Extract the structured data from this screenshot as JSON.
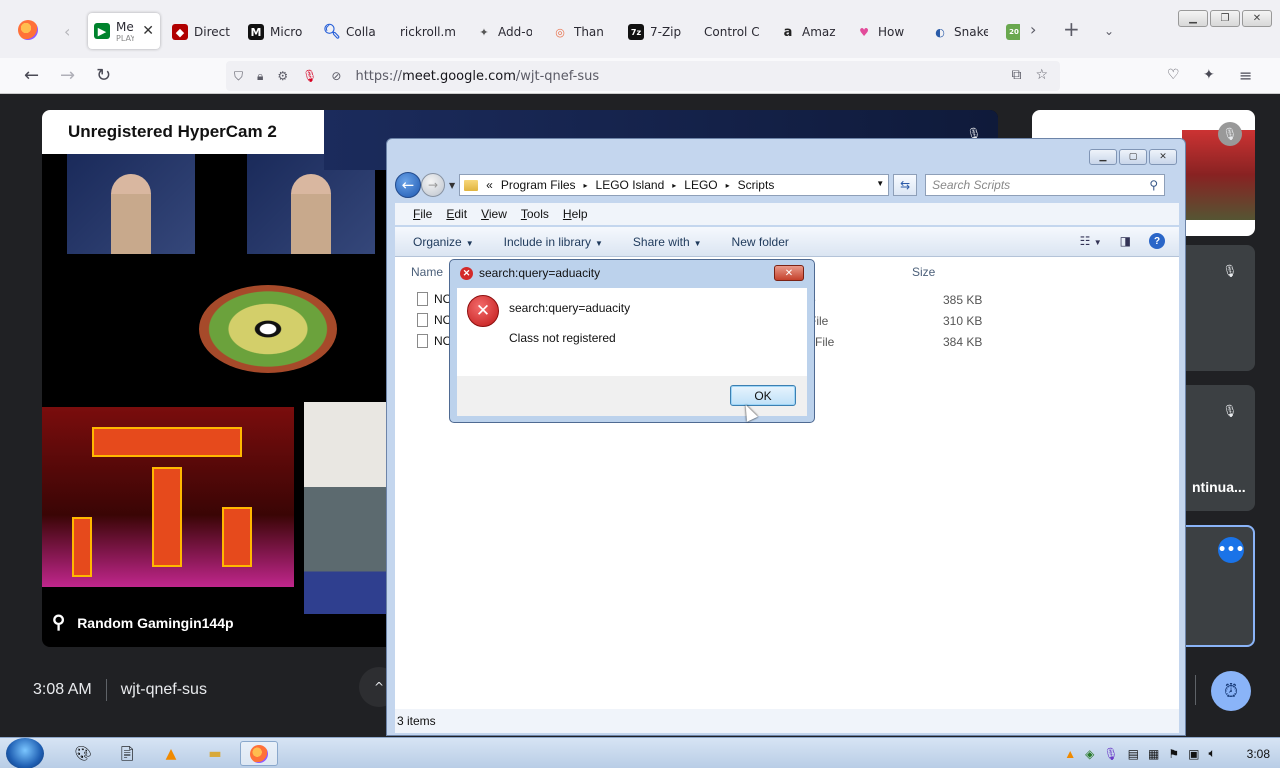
{
  "browser": {
    "tabs": [
      {
        "label": "Meet",
        "sub": "PLAYING",
        "fav_color": "#00832d",
        "fav_glyph": "▶",
        "active": true
      },
      {
        "label": "Direct",
        "fav_color": "#b10000",
        "fav_glyph": "◆"
      },
      {
        "label": "Micro",
        "fav_color": "#111111",
        "fav_glyph": "M"
      },
      {
        "label": "Colla",
        "fav_color": "#2a62d9",
        "fav_glyph": "Q"
      },
      {
        "label": "rickroll.mp",
        "fav_color": "transparent",
        "fav_glyph": ""
      },
      {
        "label": "Add-o",
        "fav_color": "#555555",
        "fav_glyph": "✦"
      },
      {
        "label": "Than",
        "fav_color": "#e8704a",
        "fav_glyph": "◎"
      },
      {
        "label": "7-Zip",
        "fav_color": "#111111",
        "fav_glyph": "7z"
      },
      {
        "label": "Control C",
        "fav_color": "transparent",
        "fav_glyph": ""
      },
      {
        "label": "Amaz",
        "fav_color": "#222222",
        "fav_glyph": "a"
      },
      {
        "label": "How",
        "fav_color": "#e24b9a",
        "fav_glyph": "♥"
      },
      {
        "label": "Snake",
        "fav_color": "#2a5ba8",
        "fav_glyph": "◐"
      },
      {
        "label": "",
        "fav_color": "#6aa84f",
        "fav_glyph": "20"
      }
    ],
    "url_prefix": "https://",
    "url_host": "meet.google.com",
    "url_path": "/wjt-qnef-sus"
  },
  "meet": {
    "overlay_label": "Unregistered HyperCam 2",
    "presenter_name": "Random Gamingin144p",
    "side_tile_name": "ntinua...",
    "time": "3:08 AM",
    "meeting_code": "wjt-qnef-sus"
  },
  "explorer": {
    "breadcrumb": [
      "«",
      "Program Files",
      "LEGO Island",
      "LEGO",
      "Scripts"
    ],
    "search_placeholder": "Search Scripts",
    "menu": [
      "File",
      "Edit",
      "View",
      "Tools",
      "Help"
    ],
    "commands": [
      "Organize",
      "Include in library",
      "Share with",
      "New folder"
    ],
    "columns": {
      "name": "Name",
      "size": "Size"
    },
    "files": [
      {
        "name": "NO",
        "type": "e",
        "size": "385 KB"
      },
      {
        "name": "NO",
        "type": "File",
        "size": "310 KB"
      },
      {
        "name": "NO",
        "type": "l File",
        "size": "384 KB"
      }
    ],
    "status": "3 items"
  },
  "dialog": {
    "title": "search:query=aduacity",
    "message": "search:query=aduacity",
    "detail": "Class not registered",
    "ok_label": "OK"
  },
  "taskbar": {
    "clock": "3:08"
  }
}
